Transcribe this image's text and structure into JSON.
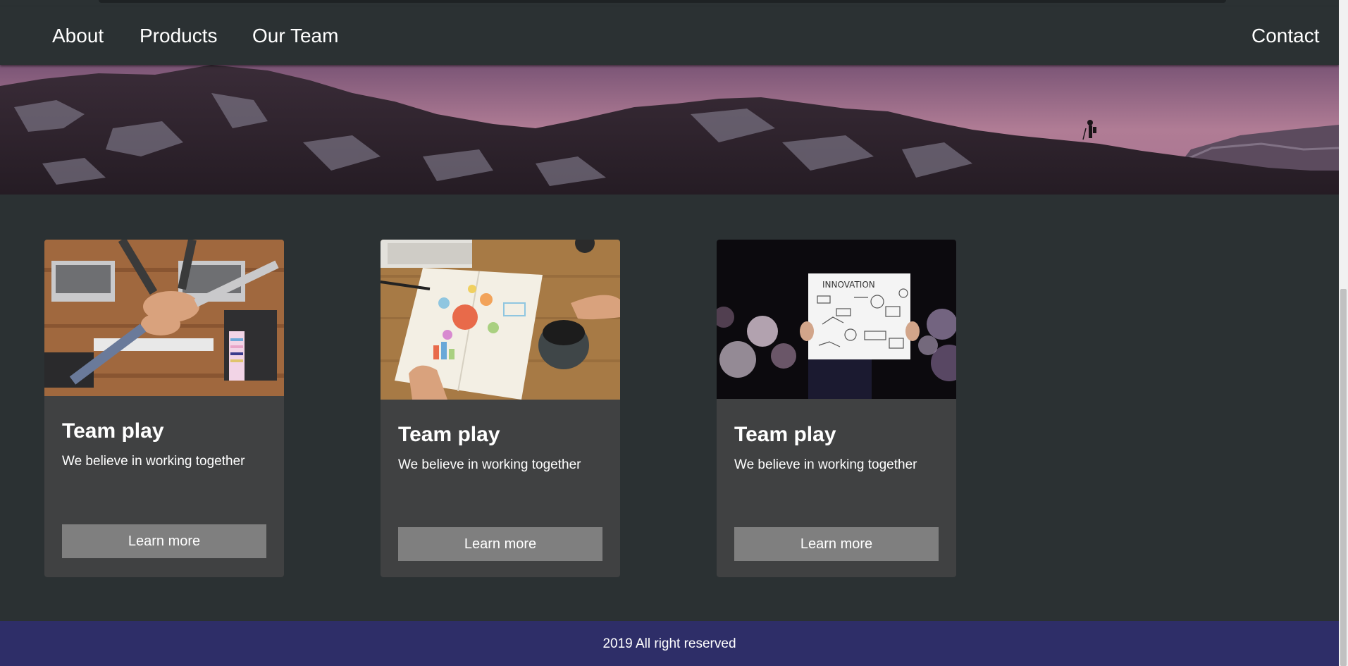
{
  "nav": {
    "links": [
      "About",
      "Products",
      "Our Team"
    ],
    "contact": "Contact"
  },
  "cards": [
    {
      "title": "Team play",
      "text": "We believe in working together",
      "button": "Learn more",
      "image": "team-hands-photo"
    },
    {
      "title": "Team play",
      "text": "We believe in working together",
      "button": "Learn more",
      "image": "notebook-coffee-photo"
    },
    {
      "title": "Team play",
      "text": "We believe in working together",
      "button": "Learn more",
      "image": "innovation-sign-photo"
    }
  ],
  "footer": {
    "text": "2019 All right reserved"
  },
  "colors": {
    "navbar": "#2b3133",
    "card": "#404142",
    "button": "#7f7f7f",
    "footer": "#2e2e68"
  }
}
